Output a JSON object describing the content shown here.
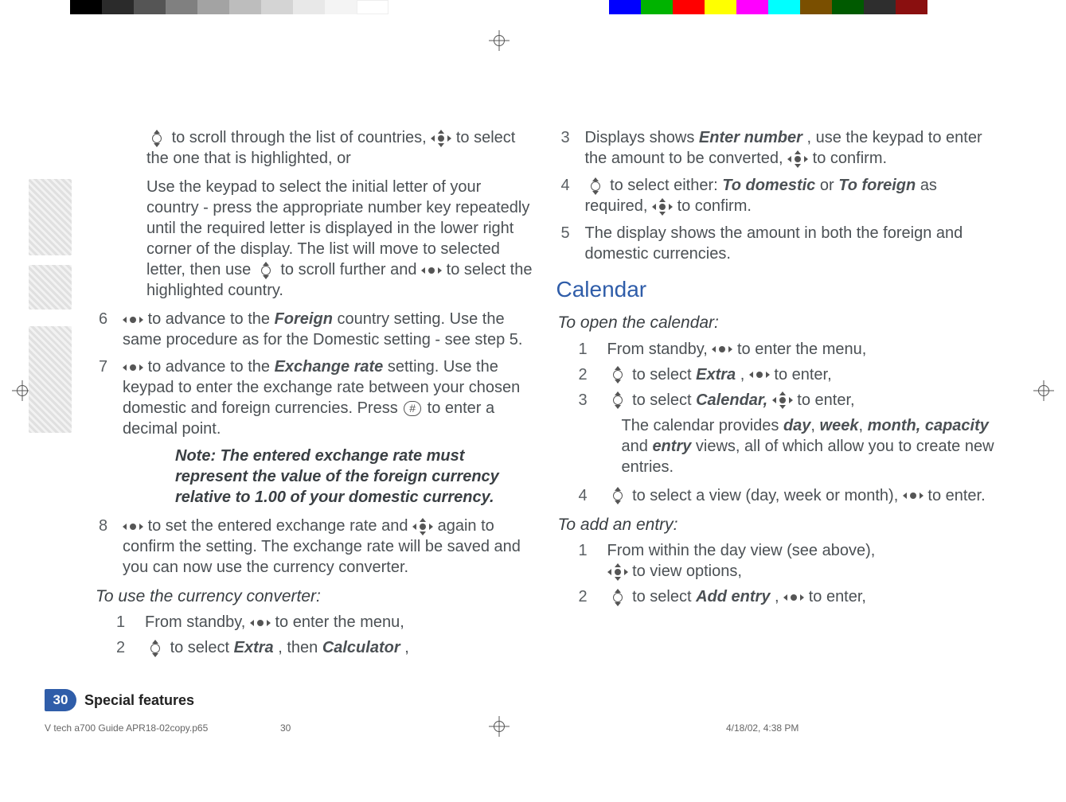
{
  "grayscale_bar": [
    "#000000",
    "#2b2b2b",
    "#555555",
    "#808080",
    "#a3a3a3",
    "#bdbdbd",
    "#d4d4d4",
    "#e8e8e8",
    "#f4f4f4",
    "#ffffff"
  ],
  "color_bar": [
    "#0000ff",
    "#00b300",
    "#ff0000",
    "#ffff00",
    "#ff00ff",
    "#00ffff",
    "#7a4f00",
    "#005a00",
    "#2e2e2e",
    "#8a0f0f"
  ],
  "left_col": {
    "scroll_para": {
      "t1": " to scroll through the list of countries, ",
      "t2": " to select the one that is highlighted, or"
    },
    "keypad_para": {
      "t1": "Use the keypad to select the initial letter of your country - press the appropriate number key repeatedly until the required letter is displayed in the lower right corner of the display. The list will move to selected letter, then use ",
      "t2": " to scroll further and ",
      "t3": " to select the highlighted country."
    },
    "step6": {
      "num": "6",
      "t1": " to advance to the ",
      "bold1": "Foreign",
      "t2": " country setting. Use the same procedure as for the Domestic setting - see step 5."
    },
    "step7": {
      "num": "7",
      "t1": " to advance to the ",
      "bold1": "Exchange rate",
      "t2": " setting. Use the keypad to enter the exchange rate between your chosen domestic and foreign currencies. Press ",
      "hash": "#",
      "t3": " to enter a decimal point."
    },
    "note": "Note: The entered exchange rate must represent the value of the foreign currency relative to 1.00 of your domestic currency.",
    "step8": {
      "num": "8",
      "t1": " to set the entered exchange rate and ",
      "t2": " again to confirm the setting. The exchange rate will be saved and you can now use the currency converter."
    },
    "use_head": "To use the currency converter:",
    "u1": {
      "num": "1",
      "t1": "From standby, ",
      "t2": " to enter the menu,"
    },
    "u2": {
      "num": "2",
      "t1": " to select ",
      "b1": "Extra",
      "t2": ", then ",
      "b2": "Calculator",
      "t3": ","
    }
  },
  "right_col": {
    "step3": {
      "num": "3",
      "t1": "Displays shows ",
      "b1": "Enter number",
      "t2": ", use the keypad to enter the amount to be converted, ",
      "t3": " to confirm."
    },
    "step4": {
      "num": "4",
      "t1": " to select either: ",
      "b1": "To domestic",
      "t2": " or ",
      "b2": "To foreign",
      "t3": " as required, ",
      "t4": " to confirm."
    },
    "step5": {
      "num": "5",
      "t": "The display shows the amount in both the foreign and domestic currencies."
    },
    "calendar_head": "Calendar",
    "open_head": "To open the calendar:",
    "o1": {
      "num": "1",
      "t1": "From standby, ",
      "t2": " to enter the menu,"
    },
    "o2": {
      "num": "2",
      "t1": " to select ",
      "b1": "Extra",
      "t2": ", ",
      "t3": " to enter,"
    },
    "o3": {
      "num": "3",
      "t1": " to select ",
      "b1": "Calendar,",
      "t2": " ",
      "t3": " to enter,"
    },
    "cal_note": {
      "t1": "The calendar provides ",
      "b1": "day",
      "b2": "week",
      "b3": "month, capacity",
      "t2": " and ",
      "b4": "entry",
      "t3": " views, all of which allow you to create new entries."
    },
    "o4": {
      "num": "4",
      "t1": " to select a view (day, week or month), ",
      "t2": " to enter."
    },
    "add_head": "To add an entry:",
    "a1": {
      "num": "1",
      "t1": "From within the day view (see above),",
      "t2": " to view options,"
    },
    "a2": {
      "num": "2",
      "t1": " to select ",
      "b1": "Add entry",
      "t2": ", ",
      "t3": " to enter,"
    }
  },
  "footer": {
    "page_num": "30",
    "section": "Special features",
    "file": "V tech a700 Guide APR18-02copy.p65",
    "page_small": "30",
    "timestamp": "4/18/02, 4:38 PM"
  }
}
